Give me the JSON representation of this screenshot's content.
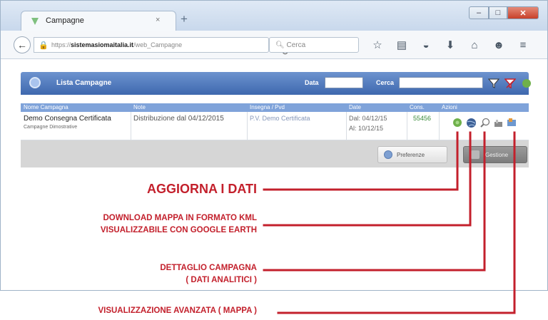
{
  "browser": {
    "tab_title": "Campagne",
    "tab_close": "×",
    "new_tab": "+",
    "url_prefix": "https://",
    "url_host": "sistemasiomaitalia.it",
    "url_path": "/web_Campagne",
    "search_placeholder": "Cerca",
    "window_controls": {
      "minimize": "–",
      "maximize": "□",
      "close": "✕"
    }
  },
  "app": {
    "title": "Lista Campagne",
    "filter_data_label": "Data",
    "filter_cerca_label": "Cerca",
    "columns": [
      "Nome Campagna",
      "Note",
      "Insegna / Pvd",
      "Date",
      "Cons.",
      "Azioni"
    ],
    "row": {
      "name": "Demo Consegna Certificata",
      "subtitle": "Campagne Dimostrative",
      "note": "Distribuzione dal 04/12/2015",
      "insegna": "P.V. Demo Certificata",
      "date_from": "Dal: 04/12/15",
      "date_to": "Al: 10/12/15",
      "cons": "55456"
    },
    "buttons": {
      "preferences": "Preferenze",
      "gestione": "Gestione"
    }
  },
  "annotations": {
    "refresh": "AGGIORNA I DATI",
    "download_line1": "DOWNLOAD MAPPA IN FORMATO KML",
    "download_line2": "VISUALIZZABILE CON GOOGLE EARTH",
    "detail_line1": "DETTAGLIO CAMPAGNA",
    "detail_line2": "( DATI ANALITICI )",
    "advanced": "VISUALIZZAZIONE AVANZATA ( MAPPA )"
  },
  "colors": {
    "annotation": "#c3202c",
    "header_blue": "#3e68ae",
    "column_header": "#7fa3da"
  }
}
